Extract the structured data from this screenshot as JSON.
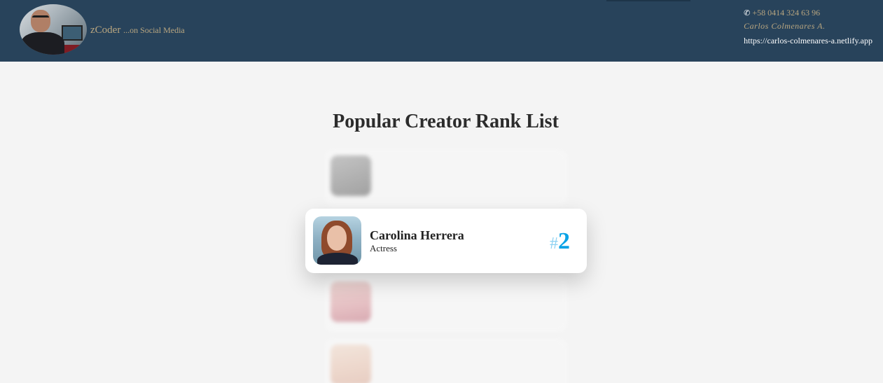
{
  "header": {
    "brand_name": "zCoder",
    "brand_tagline": "...on Social Media",
    "contact": {
      "phone": "+58 0414 324 63 96",
      "phone_icon": "phone-icon",
      "name": "Carlos Colmenares A.",
      "url": "https://carlos-colmenares-a.netlify.app"
    }
  },
  "main": {
    "title": "Popular Creator Rank List",
    "featured": {
      "name": "Carolina Herrera",
      "role": "Actress",
      "rank_prefix": "#",
      "rank": "2"
    }
  },
  "colors": {
    "header_bg": "#28435b",
    "accent_gold": "#b9a680",
    "rank_blue": "#0aa3e6",
    "page_bg": "#f4f4f4"
  }
}
